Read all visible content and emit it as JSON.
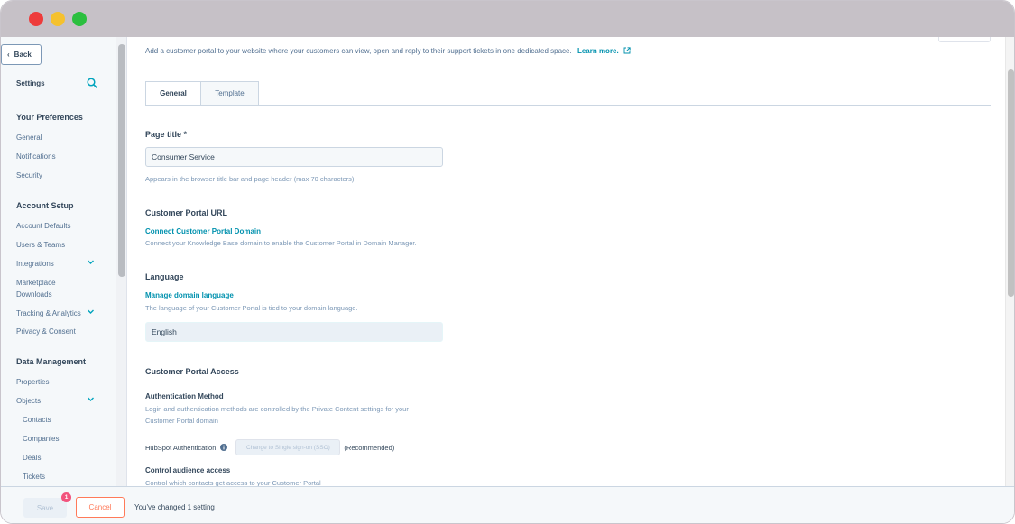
{
  "sidebar": {
    "back_label": "Back",
    "settings_label": "Settings",
    "sections": [
      {
        "title": "Your Preferences",
        "items": [
          "General",
          "Notifications",
          "Security"
        ]
      },
      {
        "title": "Account Setup",
        "items": [
          "Account Defaults",
          "Users & Teams",
          "Integrations",
          "Marketplace",
          "Downloads",
          "Tracking & Analytics",
          "Privacy & Consent"
        ]
      },
      {
        "title": "Data Management",
        "items": [
          "Properties",
          "Objects",
          "Contacts",
          "Companies",
          "Deals",
          "Tickets"
        ]
      }
    ]
  },
  "main": {
    "intro_text": "Add a customer portal to your website where your customers can view, open and reply to their support tickets in one dedicated space.",
    "learn_more": "Learn more.",
    "tabs": [
      "General",
      "Template"
    ],
    "page_title": {
      "label": "Page title *",
      "value": "Consumer Service",
      "help": "Appears in the browser title bar and page header (max 70 characters)"
    },
    "portal_url": {
      "label": "Customer Portal URL",
      "link": "Connect Customer Portal Domain",
      "help": "Connect your Knowledge Base domain to enable the Customer Portal in Domain Manager."
    },
    "language": {
      "label": "Language",
      "link": "Manage domain language",
      "help": "The language of your Customer Portal is tied to your domain language.",
      "value": "English"
    },
    "access": {
      "label": "Customer Portal Access",
      "auth_label": "Authentication Method",
      "auth_help_1": "Login and authentication methods are controlled by the Private Content settings for your",
      "auth_help_2": "Customer Portal domain",
      "hubspot_auth": "HubSpot Authentication",
      "sso_button": "Change to Single sign-on (SSO)",
      "recommended": "(Recommended)",
      "audience_label": "Control audience access",
      "audience_help": "Control which contacts get access to your Customer Portal"
    }
  },
  "footer": {
    "save_label": "Save",
    "badge_count": "1",
    "cancel_label": "Cancel",
    "changed_text": "You've changed 1 setting"
  },
  "colors": {
    "link": "#0091ae",
    "cancel": "#ff7a59",
    "badge": "#f2547d",
    "text": "#33475b"
  }
}
